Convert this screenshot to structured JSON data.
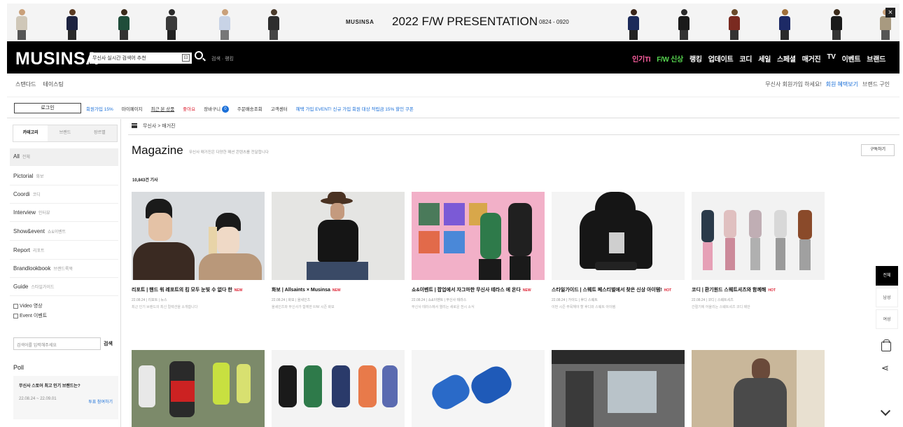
{
  "banner": {
    "brand": "MUSINSA",
    "title": "2022 F/W PRESENTATION",
    "date": "0824 - 0920",
    "close": "×"
  },
  "header": {
    "logo": "MUSINSA",
    "search_placeholder": "무신사 실시간 검색어 추천",
    "search_small": "검색 · 랭킹",
    "nav": [
      "인기TI",
      "F/W 신상",
      "랭킹",
      "업데이트",
      "코디",
      "세일",
      "스페셜",
      "매거진",
      "TV",
      "이벤트",
      "브랜드"
    ]
  },
  "subbar": {
    "left": [
      "스탠다드",
      "테이스팅"
    ],
    "right_prefix": "무신사 회원가입 하세요!",
    "right_link": "회원 혜택보기",
    "right_end": "브랜드 구인"
  },
  "links": {
    "button": "로그인",
    "items": [
      "회원가입 15%",
      "마이페이지",
      "최근 본 상품",
      "좋아요",
      "장바구니",
      "주문배송조회",
      "고객센터",
      "혜택 가입 EVENT! 신규 가입 회원 대상 적립금 15% 할인 쿠폰"
    ]
  },
  "sidebar": {
    "tabs": [
      "카테고리",
      "브랜드",
      "장르별"
    ],
    "categories": [
      {
        "name": "All",
        "k": "전체"
      },
      {
        "name": "Pictorial",
        "k": "화보"
      },
      {
        "name": "Coordi",
        "k": "코디"
      },
      {
        "name": "Interview",
        "k": "인터뷰"
      },
      {
        "name": "Show&event",
        "k": "쇼&이벤트"
      },
      {
        "name": "Report",
        "k": "리포트"
      },
      {
        "name": "Brandlookbook",
        "k": "브랜드룩북"
      },
      {
        "name": "Guide",
        "k": "스타일가이드"
      }
    ],
    "checks": [
      "Video 영상",
      "Event 이벤트"
    ],
    "search_placeholder": "검색어를 입력해주세요",
    "search_btn": "검색",
    "poll_title": "Poll",
    "poll_q": "무신사 스토어 최고 인기 브랜드는?",
    "poll_date": "22.08.24 ~ 22.09.01",
    "poll_vote": "투표 참여하기"
  },
  "main": {
    "breadcrumb": "무신사 > 매거진",
    "title": "Magazine",
    "desc": "무신사 매거진은 다양한 패션 콘텐츠를 전달합니다",
    "subscribe": "구독하기",
    "count": "10,843건 기사",
    "articles": [
      {
        "title": "리포트 | 핸드 워 레포트의 킴 모두 눈빛 수 없다 한",
        "new": "NEW",
        "meta": "22.08.24 | 리포트 | 뉴스",
        "sum": "최근 인기 브랜드의 최신 컬렉션을 소개합니다"
      },
      {
        "title": "화보 | Allsaints × Musinsa",
        "new": "NEW",
        "meta": "22.08.24 | 화보 | 올세인츠",
        "sum": "올세인츠와 무신사가 함께한 F/W 시즌 화보"
      },
      {
        "title": "쇼&이벤트 | 팝업에서 자그마한 무신사 테라스 에 온다",
        "new": "NEW",
        "meta": "22.08.24 | 쇼&이벤트 | 무신사 테라스",
        "sum": "무신사 테라스에서 열리는 새로운 전시 소식"
      },
      {
        "title": "스타일가이드 | 스웨트 페스티벌에서 찾은 신상 아이템!",
        "new": "HOT",
        "meta": "22.08.24 | 가이드 | 후디 스웨트",
        "sum": "이번 시즌 주목해야 할 후디와 스웨트 아이템"
      },
      {
        "title": "코디 | 환기원드 스웨트셔츠와 함께해",
        "new": "HOT",
        "meta": "22.08.24 | 코디 | 스웨트셔츠",
        "sum": "간절기에 어울리는 스웨트셔츠 코디 제안"
      }
    ]
  },
  "rail": [
    "전체",
    "남성",
    "여성"
  ]
}
